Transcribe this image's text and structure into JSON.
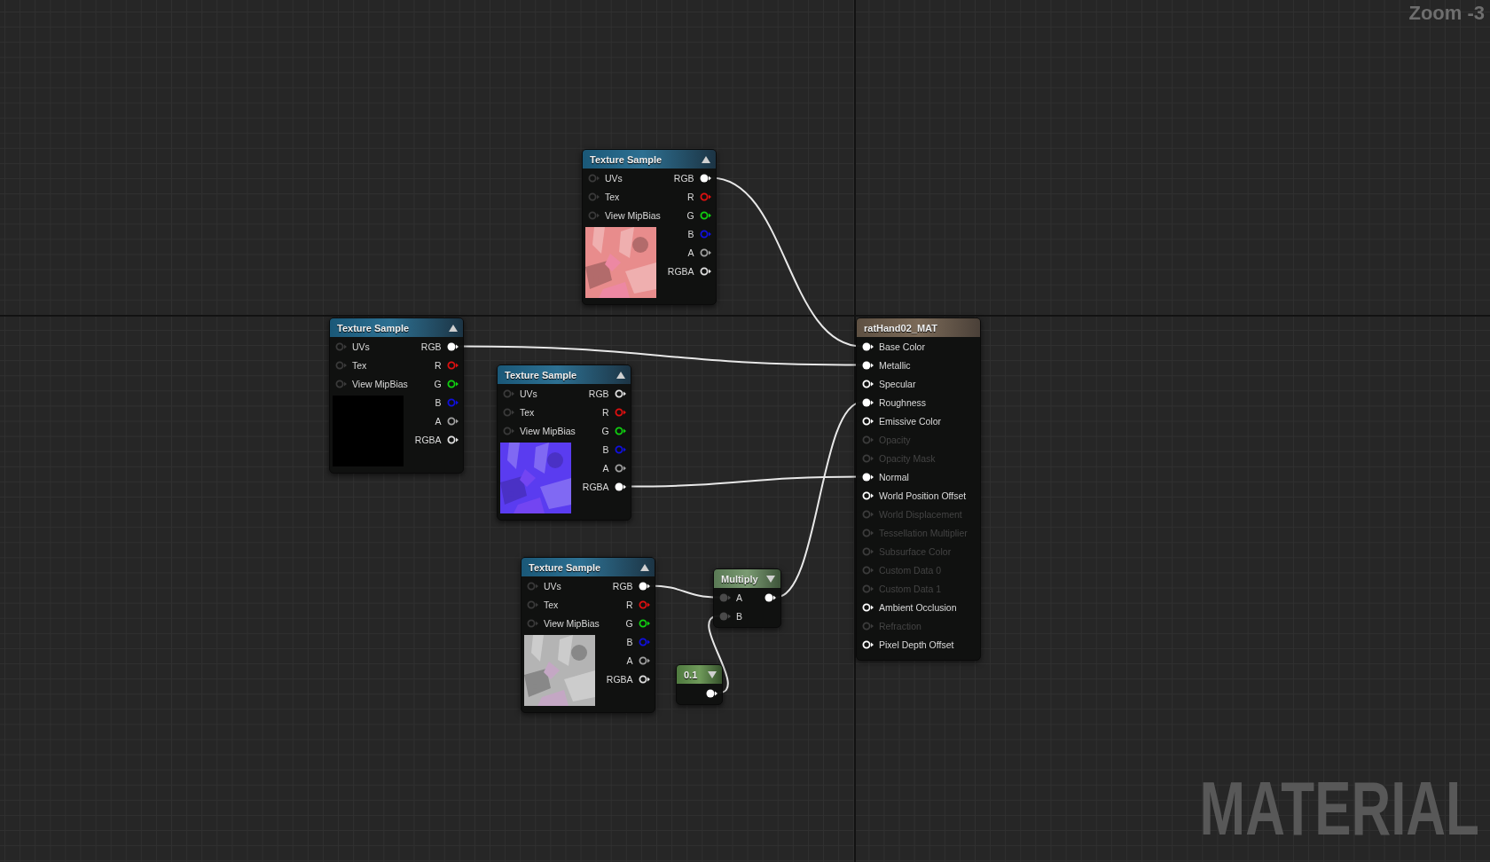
{
  "zoom_label": "Zoom -3",
  "nodes": [
    {
      "kind": "texture",
      "title": "Texture Sample",
      "expanded": true,
      "preview": {
        "kind": "picture",
        "color": "#e88c8c"
      },
      "inputs": [
        {
          "label": "UVs",
          "color": "#3a3a3a",
          "connected": false
        },
        {
          "label": "Tex",
          "color": "#3a3a3a",
          "connected": false
        },
        {
          "label": "View MipBias",
          "color": "#3a3a3a",
          "connected": false
        }
      ],
      "outputs": [
        {
          "label": "RGB",
          "color": "#ffffff",
          "connected": true
        },
        {
          "label": "R",
          "color": "#e01010",
          "connected": false
        },
        {
          "label": "G",
          "color": "#10d010",
          "connected": false
        },
        {
          "label": "B",
          "color": "#1010e0",
          "connected": false
        },
        {
          "label": "A",
          "color": "#a0a0a0",
          "connected": false
        },
        {
          "label": "RGBA",
          "color": "#e0e0e0",
          "connected": false
        }
      ]
    },
    {
      "kind": "texture",
      "title": "Texture Sample",
      "expanded": true,
      "preview": {
        "kind": "picture",
        "color": "#000000"
      },
      "inputs": [
        {
          "label": "UVs",
          "color": "#3a3a3a",
          "connected": false
        },
        {
          "label": "Tex",
          "color": "#3a3a3a",
          "connected": false
        },
        {
          "label": "View MipBias",
          "color": "#3a3a3a",
          "connected": false
        }
      ],
      "outputs": [
        {
          "label": "RGB",
          "color": "#ffffff",
          "connected": true
        },
        {
          "label": "R",
          "color": "#e01010",
          "connected": false
        },
        {
          "label": "G",
          "color": "#10d010",
          "connected": false
        },
        {
          "label": "B",
          "color": "#1010e0",
          "connected": false
        },
        {
          "label": "A",
          "color": "#a0a0a0",
          "connected": false
        },
        {
          "label": "RGBA",
          "color": "#e0e0e0",
          "connected": false
        }
      ]
    },
    {
      "kind": "texture",
      "title": "Texture Sample",
      "expanded": true,
      "preview": {
        "kind": "picture",
        "color": "#5a3cf0"
      },
      "inputs": [
        {
          "label": "UVs",
          "color": "#3a3a3a",
          "connected": false
        },
        {
          "label": "Tex",
          "color": "#3a3a3a",
          "connected": false
        },
        {
          "label": "View MipBias",
          "color": "#3a3a3a",
          "connected": false
        }
      ],
      "outputs": [
        {
          "label": "RGB",
          "color": "#e0e0e0",
          "connected": false
        },
        {
          "label": "R",
          "color": "#e01010",
          "connected": false
        },
        {
          "label": "G",
          "color": "#10d010",
          "connected": false
        },
        {
          "label": "B",
          "color": "#1010e0",
          "connected": false
        },
        {
          "label": "A",
          "color": "#a0a0a0",
          "connected": false
        },
        {
          "label": "RGBA",
          "color": "#ffffff",
          "connected": true
        }
      ]
    },
    {
      "kind": "texture",
      "title": "Texture Sample",
      "expanded": true,
      "preview": {
        "kind": "picture",
        "color": "#b4b4b4"
      },
      "inputs": [
        {
          "label": "UVs",
          "color": "#3a3a3a",
          "connected": false
        },
        {
          "label": "Tex",
          "color": "#3a3a3a",
          "connected": false
        },
        {
          "label": "View MipBias",
          "color": "#3a3a3a",
          "connected": false
        }
      ],
      "outputs": [
        {
          "label": "RGB",
          "color": "#ffffff",
          "connected": true
        },
        {
          "label": "R",
          "color": "#e01010",
          "connected": false
        },
        {
          "label": "G",
          "color": "#10d010",
          "connected": false
        },
        {
          "label": "B",
          "color": "#1010e0",
          "connected": false
        },
        {
          "label": "A",
          "color": "#a0a0a0",
          "connected": false
        },
        {
          "label": "RGBA",
          "color": "#e0e0e0",
          "connected": false
        }
      ]
    },
    {
      "kind": "math",
      "title": "Multiply",
      "expanded": false,
      "inputs": [
        {
          "label": "A",
          "color": "#4a4a4a",
          "connected": true
        },
        {
          "label": "B",
          "color": "#4a4a4a",
          "connected": true
        }
      ],
      "outputs": [
        {
          "color": "#ffffff",
          "connected": true
        }
      ]
    },
    {
      "kind": "constant",
      "title": "0.1",
      "expanded": false,
      "outputs": [
        {
          "color": "#ffffff",
          "connected": true
        }
      ]
    },
    {
      "kind": "result",
      "title": "ratHand02_MAT",
      "inputs": [
        {
          "label": "Base Color",
          "color": "#ffffff",
          "connected": true,
          "disabled": false
        },
        {
          "label": "Metallic",
          "color": "#ffffff",
          "connected": true,
          "disabled": false
        },
        {
          "label": "Specular",
          "color": "#ffffff",
          "connected": false,
          "disabled": false
        },
        {
          "label": "Roughness",
          "color": "#ffffff",
          "connected": true,
          "disabled": false
        },
        {
          "label": "Emissive Color",
          "color": "#ffffff",
          "connected": false,
          "disabled": false
        },
        {
          "label": "Opacity",
          "color": "#3c3c3c",
          "connected": false,
          "disabled": true
        },
        {
          "label": "Opacity Mask",
          "color": "#3c3c3c",
          "connected": false,
          "disabled": true
        },
        {
          "label": "Normal",
          "color": "#ffffff",
          "connected": true,
          "disabled": false
        },
        {
          "label": "World Position Offset",
          "color": "#ffffff",
          "connected": false,
          "disabled": false
        },
        {
          "label": "World Displacement",
          "color": "#3c3c3c",
          "connected": false,
          "disabled": true
        },
        {
          "label": "Tessellation Multiplier",
          "color": "#3c3c3c",
          "connected": false,
          "disabled": true
        },
        {
          "label": "Subsurface Color",
          "color": "#3c3c3c",
          "connected": false,
          "disabled": true
        },
        {
          "label": "Custom Data 0",
          "color": "#3c3c3c",
          "connected": false,
          "disabled": true
        },
        {
          "label": "Custom Data 1",
          "color": "#3c3c3c",
          "connected": false,
          "disabled": true
        },
        {
          "label": "Ambient Occlusion",
          "color": "#ffffff",
          "connected": false,
          "disabled": false
        },
        {
          "label": "Refraction",
          "color": "#3c3c3c",
          "connected": false,
          "disabled": true
        },
        {
          "label": "Pixel Depth Offset",
          "color": "#ffffff",
          "connected": false,
          "disabled": false
        }
      ]
    }
  ],
  "graph_type_label": "MATERIAL"
}
